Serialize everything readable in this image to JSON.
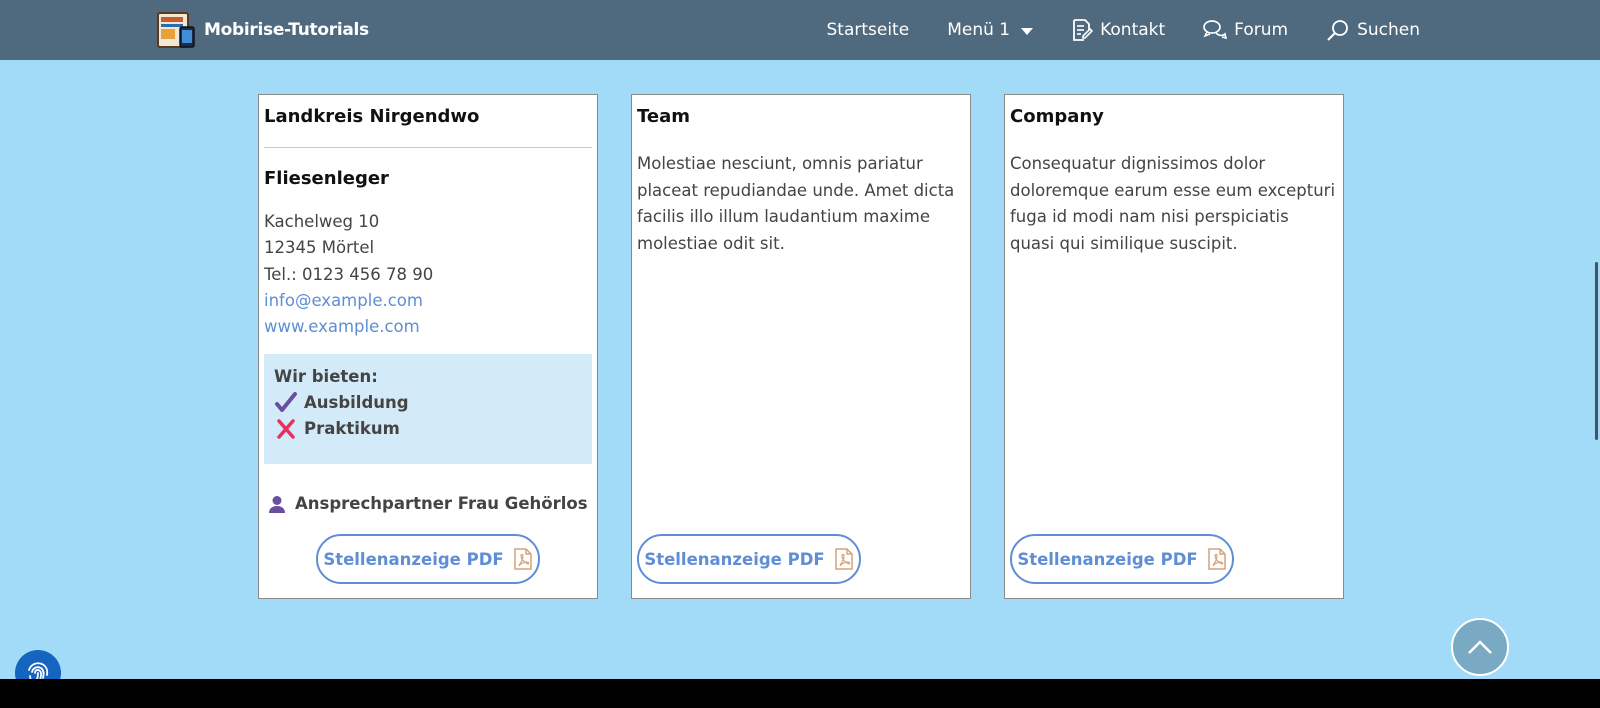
{
  "navbar": {
    "brand": "Mobirise-Tutorials",
    "items": [
      {
        "label": "Startseite",
        "icon": null
      },
      {
        "label": "Menü 1",
        "icon": "chevron-down-icon"
      },
      {
        "label": "Kontakt",
        "icon": "document-edit-icon"
      },
      {
        "label": "Forum",
        "icon": "chat-bubbles-icon"
      },
      {
        "label": "Suchen",
        "icon": "search-icon"
      }
    ]
  },
  "cards": [
    {
      "title": "Landkreis Nirgendwo",
      "subtitle": "Fliesenleger",
      "address": [
        "Kachelweg 10",
        "12345 Mörtel",
        "Tel.: 0123 456 78 90"
      ],
      "email": "info@example.com",
      "website": "www.example.com",
      "offers": {
        "heading": "Wir bieten:",
        "items": [
          {
            "label": "Ausbildung",
            "status": "yes"
          },
          {
            "label": "Praktikum",
            "status": "no"
          }
        ]
      },
      "contact": "Ansprechpartner Frau Gehörlos",
      "button": "Stellenanzeige PDF"
    },
    {
      "title": "Team",
      "text": "Molestiae nesciunt, omnis pariatur placeat repudiandae unde. Amet dicta facilis illo illum laudantium maxime molestiae odit sit.",
      "button": "Stellenanzeige PDF"
    },
    {
      "title": "Company",
      "text": "Consequatur dignissimos dolor doloremque earum esse eum excepturi fuga id modi nam nisi perspiciatis quasi qui similique suscipit.",
      "button": "Stellenanzeige PDF"
    }
  ],
  "colors": {
    "navbar": "#4f6a7e",
    "background": "#a1dbf7",
    "link": "#5f8ed4",
    "check": "#6a4fa0",
    "cross": "#e8315e",
    "offers_bg": "#d3ebf9"
  }
}
